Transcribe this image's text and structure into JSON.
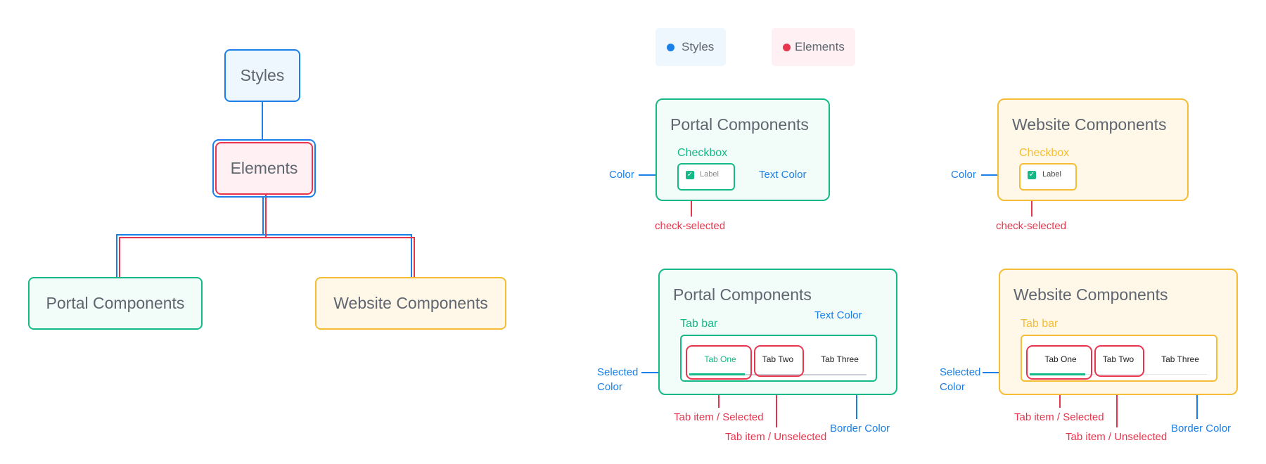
{
  "colors": {
    "styles": "#1a7fe8",
    "elements": "#e8354e",
    "portal": "#15b887",
    "website": "#f4bd35",
    "node_text": "#5f6670"
  },
  "tree": {
    "styles": "Styles",
    "elements": "Elements",
    "portal": "Portal Components",
    "website": "Website Components"
  },
  "legend": [
    {
      "label": "Styles",
      "color": "#1a7fe8"
    },
    {
      "label": "Elements",
      "color": "#e8354e"
    }
  ],
  "checkbox_cards": [
    {
      "title": "Portal Components",
      "component": "Checkbox",
      "checkbox_label": "Label",
      "annotations": {
        "color": "Color",
        "text_color": "Text Color",
        "check_selected": "check-selected"
      }
    },
    {
      "title": "Website Components",
      "component": "Checkbox",
      "checkbox_label": "Label",
      "annotations": {
        "color": "Color",
        "check_selected": "check-selected"
      }
    }
  ],
  "tab_cards": [
    {
      "title": "Portal Components",
      "component": "Tab bar",
      "tabs": [
        "Tab One",
        "Tab Two",
        "Tab Three"
      ],
      "selected_tab": 0,
      "annotations": {
        "text_color": "Text Color",
        "selected_color_1": "Selected",
        "selected_color_2": "Color",
        "tab_selected": "Tab item / Selected",
        "tab_unselected": "Tab item / Unselected",
        "border_color": "Border Color"
      }
    },
    {
      "title": "Website Components",
      "component": "Tab bar",
      "tabs": [
        "Tab One",
        "Tab Two",
        "Tab Three"
      ],
      "selected_tab": 0,
      "annotations": {
        "selected_color_1": "Selected",
        "selected_color_2": "Color",
        "tab_selected": "Tab item / Selected",
        "tab_unselected": "Tab item / Unselected",
        "border_color": "Border Color"
      }
    }
  ]
}
